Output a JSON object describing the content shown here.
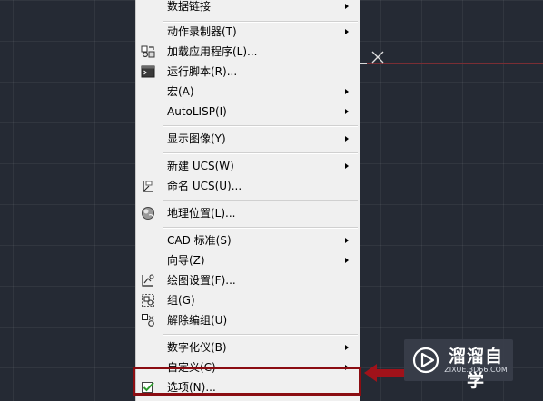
{
  "menu": {
    "items": [
      {
        "label": "数据链接",
        "submenu": true,
        "icon": ""
      },
      {
        "label": "动作录制器(T)",
        "submenu": true,
        "icon": ""
      },
      {
        "label": "加载应用程序(L)...",
        "submenu": false,
        "icon": "load-app-icon"
      },
      {
        "label": "运行脚本(R)...",
        "submenu": false,
        "icon": "run-script-icon"
      },
      {
        "label": "宏(A)",
        "submenu": true,
        "icon": ""
      },
      {
        "label": "AutoLISP(I)",
        "submenu": true,
        "icon": ""
      },
      {
        "label": "显示图像(Y)",
        "submenu": true,
        "icon": ""
      },
      {
        "label": "新建 UCS(W)",
        "submenu": true,
        "icon": ""
      },
      {
        "label": "命名 UCS(U)...",
        "submenu": false,
        "icon": "named-ucs-icon"
      },
      {
        "label": "地理位置(L)...",
        "submenu": false,
        "icon": "globe-icon"
      },
      {
        "label": "CAD 标准(S)",
        "submenu": true,
        "icon": ""
      },
      {
        "label": "向导(Z)",
        "submenu": true,
        "icon": ""
      },
      {
        "label": "绘图设置(F)...",
        "submenu": false,
        "icon": "drafting-settings-icon"
      },
      {
        "label": "组(G)",
        "submenu": false,
        "icon": "group-icon"
      },
      {
        "label": "解除编组(U)",
        "submenu": false,
        "icon": "ungroup-icon"
      },
      {
        "label": "数字化仪(B)",
        "submenu": true,
        "icon": ""
      },
      {
        "label": "自定义(C)",
        "submenu": true,
        "icon": ""
      },
      {
        "label": "选项(N)...",
        "submenu": false,
        "icon": "options-check-icon"
      }
    ]
  },
  "watermark": {
    "title": "溜溜自学",
    "url": "ZIXUE.3D66.COM"
  },
  "colors": {
    "canvas_background": "#252a34",
    "menu_background": "#f0f0f0",
    "highlight_border": "#8b0d12",
    "callout_arrow": "#a0121a",
    "axis_red": "#7a2e34"
  }
}
